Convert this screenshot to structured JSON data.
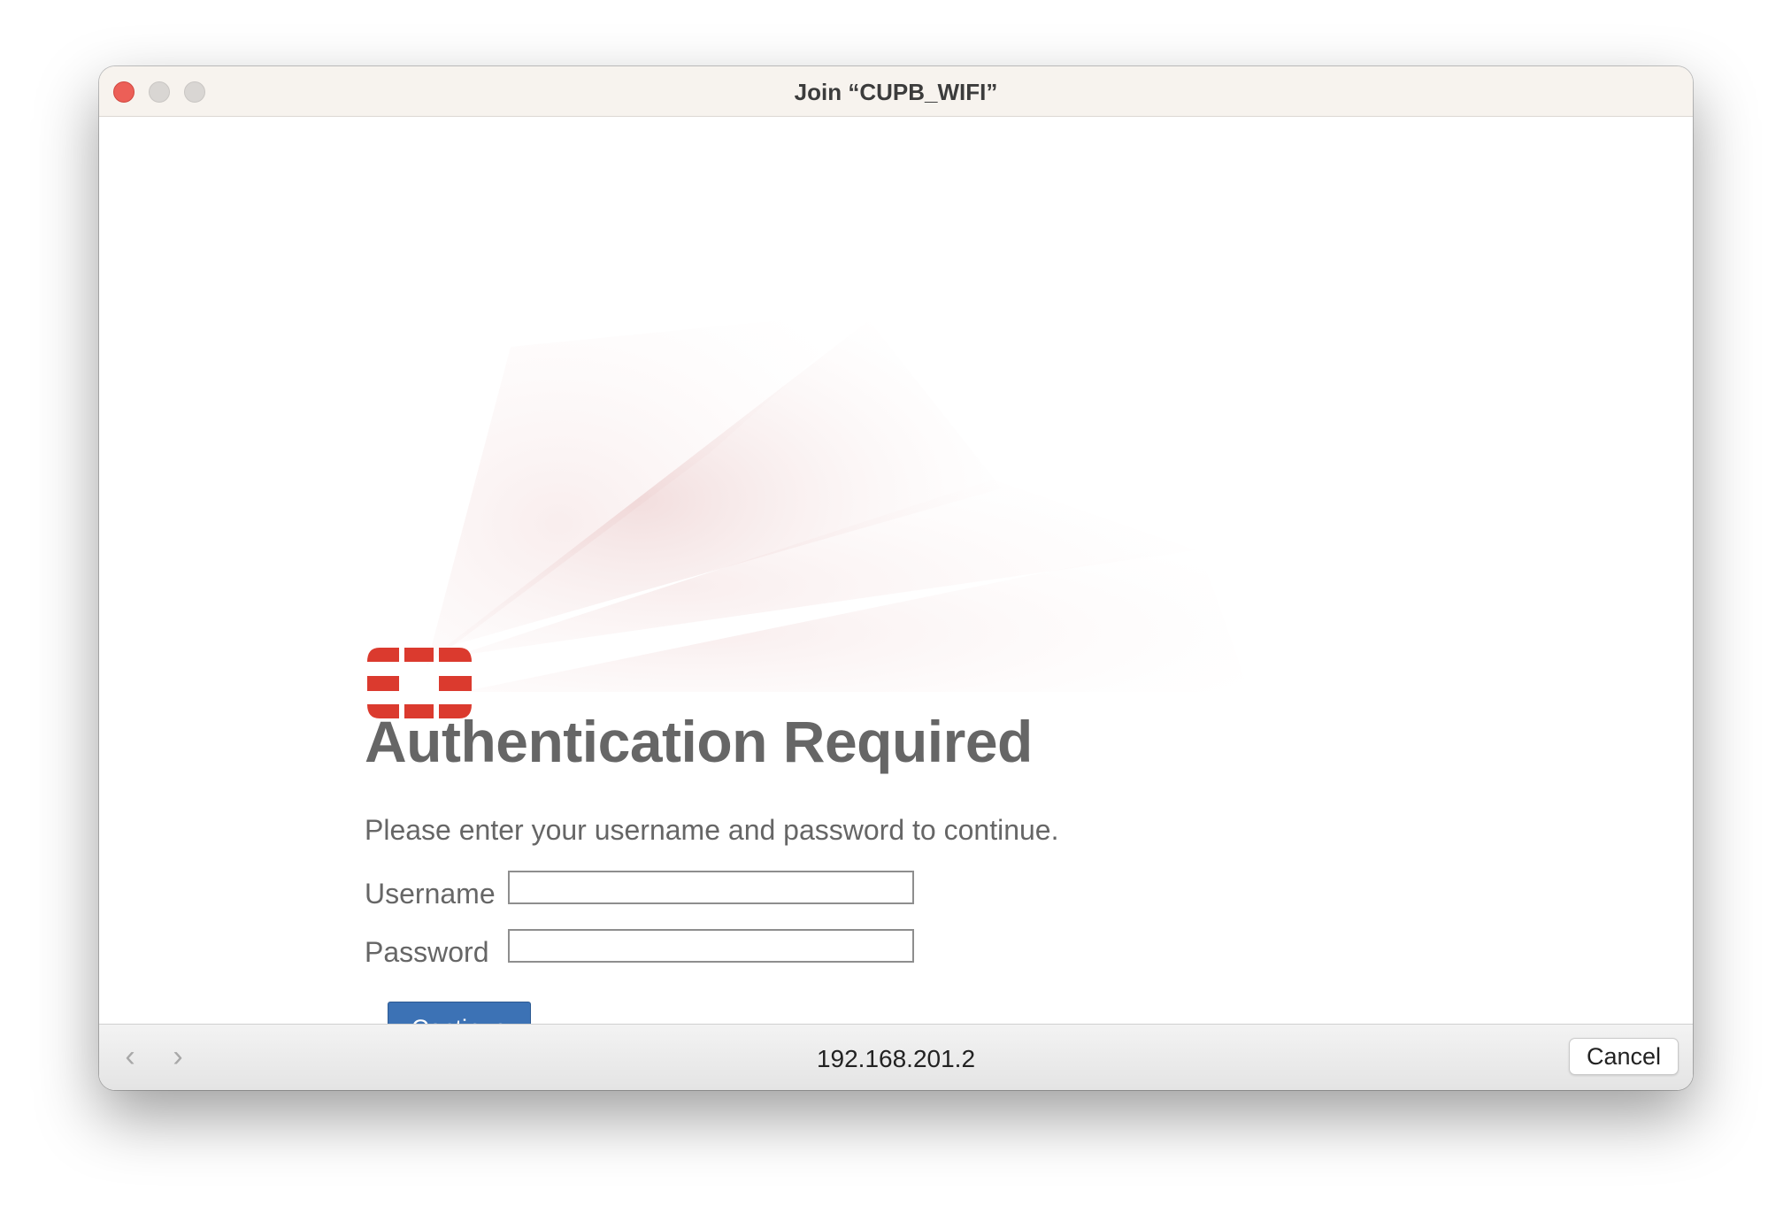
{
  "window": {
    "title": "Join “CUPB_WIFI”"
  },
  "page": {
    "heading": "Authentication Required",
    "instructions": "Please enter your username and password to continue.",
    "username_label": "Username",
    "username_value": "",
    "password_label": "Password",
    "password_value": "",
    "continue_label": "Continue"
  },
  "bottombar": {
    "back_icon": "‹",
    "forward_icon": "›",
    "url": "192.168.201.2",
    "cancel_label": "Cancel"
  },
  "colors": {
    "brand_red": "#db3a2e",
    "button_blue": "#3c72b5",
    "text_gray": "#666666"
  },
  "icons": [
    "close-icon",
    "minimize-icon",
    "maximize-icon",
    "fortinet-logo",
    "back-icon",
    "forward-icon"
  ]
}
